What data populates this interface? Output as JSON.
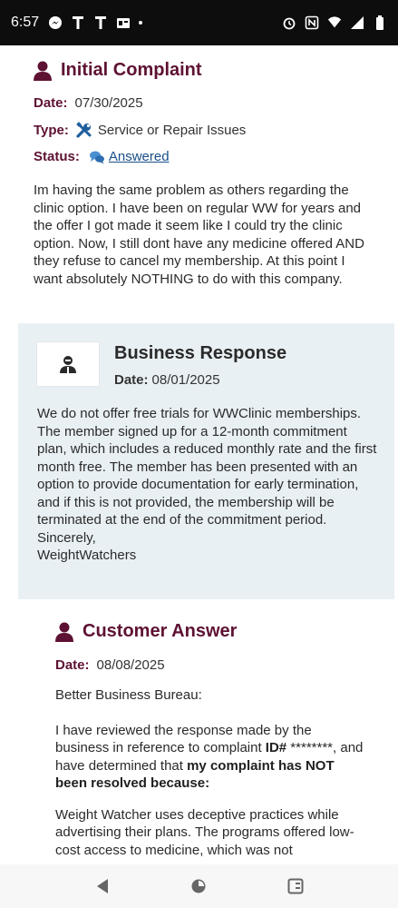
{
  "status_bar": {
    "time": "6:57",
    "left_icons": [
      "messenger-icon",
      "tmobile-icon",
      "tmobile-icon",
      "media-icon",
      "dot"
    ],
    "right_icons": [
      "alarm-icon",
      "nfc-icon",
      "wifi-icon",
      "signal-icon",
      "battery-icon"
    ]
  },
  "complaint": {
    "title": "Initial Complaint",
    "date_label": "Date:",
    "date": "07/30/2025",
    "type_label": "Type:",
    "type": "Service or Repair Issues",
    "status_label": "Status:",
    "status": "Answered",
    "body": "Im having the same problem as others regarding the clinic option. I have been on regular WW for years and the offer I got made it seem like I could try the clinic option. Now, I still dont have any medicine offered AND they refuse to cancel my membership. At this point I want absolutely NOTHING to do with this company."
  },
  "response": {
    "title": "Business Response",
    "date_label": "Date:",
    "date": "08/01/2025",
    "body": "We do not offer free trials for WWClinic memberships. The member signed up for a 12-month commitment plan, which includes a reduced monthly rate and the first month free. The member has been presented with an option to provide documentation for early termination, and if this is not provided, the membership will be terminated at the end of the commitment period.",
    "signoff": "Sincerely,",
    "signature": "WeightWatchers"
  },
  "answer": {
    "title": "Customer Answer",
    "date_label": "Date:",
    "date": "08/08/2025",
    "greeting": "Better Business Bureau:",
    "p1_a": "I have reviewed the response made by the business in reference to complaint ",
    "p1_id_label": "ID#",
    "p1_id_value": " ********",
    "p1_b": ", and have determined that ",
    "p1_bold": "my complaint has NOT been resolved because:",
    "p2": "Weight Watcher uses deceptive practices while advertising their plans. The programs offered low-cost access to medicine, which was not"
  },
  "colors": {
    "accent": "#5e1233",
    "link": "#1a4f8a",
    "response_bg": "#e9f0f4",
    "wrench": "#1f5f9e"
  }
}
